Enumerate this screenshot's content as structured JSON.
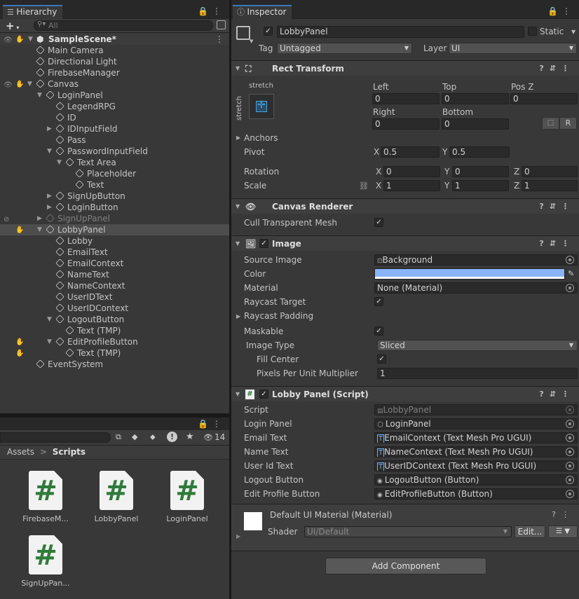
{
  "hierarchy": {
    "tab": "Hierarchy",
    "search_placeholder": "All",
    "add_button": "+",
    "scene": "SampleScene*",
    "items": [
      {
        "label": "Main Camera"
      },
      {
        "label": "Directional Light"
      },
      {
        "label": "FirebaseManager"
      },
      {
        "label": "Canvas"
      },
      {
        "label": "LoginPanel"
      },
      {
        "label": "LegendRPG"
      },
      {
        "label": "ID"
      },
      {
        "label": "IDInputField"
      },
      {
        "label": "Pass"
      },
      {
        "label": "PasswordInputField"
      },
      {
        "label": "Text Area"
      },
      {
        "label": "Placeholder"
      },
      {
        "label": "Text"
      },
      {
        "label": "SignUpButton"
      },
      {
        "label": "LoginButton"
      },
      {
        "label": "SignUpPanel"
      },
      {
        "label": "LobbyPanel"
      },
      {
        "label": "Lobby"
      },
      {
        "label": "EmailText"
      },
      {
        "label": "EmailContext"
      },
      {
        "label": "NameText"
      },
      {
        "label": "NameContext"
      },
      {
        "label": "UserIDText"
      },
      {
        "label": "UserIDContext"
      },
      {
        "label": "LogoutButton"
      },
      {
        "label": "Text (TMP)"
      },
      {
        "label": "EditProfileButton"
      },
      {
        "label": "Text (TMP)"
      },
      {
        "label": "EventSystem"
      }
    ]
  },
  "project": {
    "breadcrumb_root": "Assets",
    "breadcrumb_sep": ">",
    "breadcrumb_current": "Scripts",
    "hidden_count": "14",
    "assets": [
      {
        "name": "FirebaseM...",
        "glyph": "#"
      },
      {
        "name": "LobbyPanel",
        "glyph": "#"
      },
      {
        "name": "LoginPanel",
        "glyph": "#"
      },
      {
        "name": "SignUpPan...",
        "glyph": "#"
      }
    ]
  },
  "inspector": {
    "tab": "Inspector",
    "object_name": "LobbyPanel",
    "static_label": "Static",
    "tag_label": "Tag",
    "tag_value": "Untagged",
    "layer_label": "Layer",
    "layer_value": "UI",
    "rect": {
      "title": "Rect Transform",
      "stretch_h": "stretch",
      "stretch_v": "stretch",
      "left_label": "Left",
      "left": "0",
      "top_label": "Top",
      "top": "0",
      "posz_label": "Pos Z",
      "posz": "0",
      "right_label": "Right",
      "right": "0",
      "bottom_label": "Bottom",
      "bottom": "0",
      "r_button": "R",
      "anchors": "Anchors",
      "pivot": "Pivot",
      "pivot_x": "0.5",
      "pivot_y": "0.5",
      "rotation": "Rotation",
      "rot_x": "0",
      "rot_y": "0",
      "rot_z": "0",
      "scale": "Scale",
      "scale_x": "1",
      "scale_y": "1",
      "scale_z": "1",
      "x": "X",
      "y": "Y",
      "z": "Z"
    },
    "canvas_renderer": {
      "title": "Canvas Renderer",
      "cull_label": "Cull Transparent Mesh"
    },
    "image": {
      "title": "Image",
      "source_label": "Source Image",
      "source_value": "Background",
      "color_label": "Color",
      "color_value": "#8ab4f8",
      "material_label": "Material",
      "material_value": "None (Material)",
      "raycast_label": "Raycast Target",
      "raycast_padding": "Raycast Padding",
      "maskable_label": "Maskable",
      "type_label": "Image Type",
      "type_value": "Sliced",
      "fill_center": "Fill Center",
      "ppu_label": "Pixels Per Unit Multiplier",
      "ppu_value": "1"
    },
    "script": {
      "title": "Lobby Panel (Script)",
      "script_label": "Script",
      "script_value": "LobbyPanel",
      "fields": [
        {
          "label": "Login Panel",
          "value": "LoginPanel"
        },
        {
          "label": "Email Text",
          "value": "EmailContext (Text Mesh Pro UGUI)"
        },
        {
          "label": "Name Text",
          "value": "NameContext (Text Mesh Pro UGUI)"
        },
        {
          "label": "User Id Text",
          "value": "UserIDContext (Text Mesh Pro UGUI)"
        },
        {
          "label": "Logout Button",
          "value": "LogoutButton (Button)"
        },
        {
          "label": "Edit Profile Button",
          "value": "EditProfileButton (Button)"
        }
      ]
    },
    "material": {
      "title": "Default UI Material (Material)",
      "shader_label": "Shader",
      "shader_value": "UI/Default",
      "edit_button": "Edit..."
    },
    "add_component": "Add Component"
  }
}
